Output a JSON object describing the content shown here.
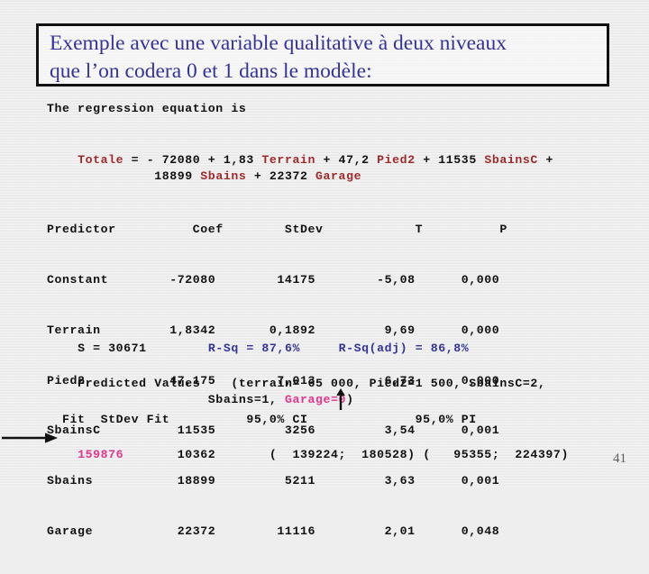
{
  "slide": {
    "page_number": "41",
    "title": {
      "line1": "Exemple avec une variable qualitative à deux niveaux",
      "line2": "que l’on codera 0 et 1 dans le modèle:"
    },
    "colors": {
      "title_text": "#333399",
      "variable_red": "#9e2a2a",
      "stat_blue": "#333399",
      "highlight_pink": "#e0368c",
      "body_black": "#111111",
      "background": "#eeeeee",
      "title_border": "#111111"
    },
    "output": {
      "intro": "The regression equation is",
      "equation": {
        "line1": [
          {
            "text": "Totale",
            "color": "red"
          },
          {
            "text": " = - 72080 + 1,83 ",
            "color": "black"
          },
          {
            "text": "Terrain",
            "color": "red"
          },
          {
            "text": " + 47,2 ",
            "color": "black"
          },
          {
            "text": "Pied2",
            "color": "red"
          },
          {
            "text": " + 11535 ",
            "color": "black"
          },
          {
            "text": "SbainsC",
            "color": "red"
          },
          {
            "text": " +",
            "color": "black"
          }
        ],
        "line2": [
          {
            "text": "          18899 ",
            "color": "black"
          },
          {
            "text": "Sbains",
            "color": "red"
          },
          {
            "text": " + 22372 ",
            "color": "black"
          },
          {
            "text": "Garage",
            "color": "red"
          }
        ]
      },
      "table": {
        "headers": [
          "Predictor",
          "Coef",
          "StDev",
          "T",
          "P"
        ],
        "rows": [
          {
            "predictor": "Constant",
            "coef": "-72080",
            "stdev": "14175",
            "t": "-5,08",
            "p": "0,000"
          },
          {
            "predictor": "Terrain",
            "coef": "1,8342",
            "stdev": "0,1892",
            "t": "9,69",
            "p": "0,000"
          },
          {
            "predictor": "Pied2",
            "coef": "47,175",
            "stdev": "7,013",
            "t": "6,73",
            "p": "0,000"
          },
          {
            "predictor": "SbainsC",
            "coef": "11535",
            "stdev": "3256",
            "t": "3,54",
            "p": "0,001"
          },
          {
            "predictor": "Sbains",
            "coef": "18899",
            "stdev": "5211",
            "t": "3,63",
            "p": "0,001"
          },
          {
            "predictor": "Garage",
            "coef": "22372",
            "stdev": "11116",
            "t": "2,01",
            "p": "0,048"
          }
        ],
        "text_lines": [
          "Predictor          Coef        StDev            T          P",
          "Constant        -72080        14175        -5,08      0,000",
          "Terrain         1,8342       0,1892         9,69      0,000",
          "Pied2           47,175        7,013         6,73      0,000",
          "SbainsC          11535         3256         3,54      0,001",
          "Sbains           18899         5211         3,63      0,001",
          "Garage           22372        11116         2,01      0,048"
        ]
      },
      "stats": {
        "s_label": "S = 30671",
        "rsq": "R-Sq = 87,6%",
        "rsq_adj": "R-Sq(adj) = 86,8%"
      },
      "predicted": {
        "label": "Predicted Values",
        "conditions_line1": "(terrain= 65 000, Pied2=1 500, SbainsC=2,",
        "conditions_line2_prefix": "Sbains=1, ",
        "conditions_line2_highlight": "Garage=0",
        "conditions_line2_suffix": ")"
      },
      "fit": {
        "header": "  Fit  StDev Fit          95,0% CI              95,0% PI",
        "value": "159876",
        "stdev_fit": "10362",
        "ci": "(  139224;  180528)",
        "pi": "(   95355;  224397)",
        "row_after_value": "       10362       (  139224;  180528) (   95355;  224397)"
      }
    },
    "annotations": {
      "up_arrow_target": "Garage=0",
      "left_arrow_target": "159876"
    }
  }
}
